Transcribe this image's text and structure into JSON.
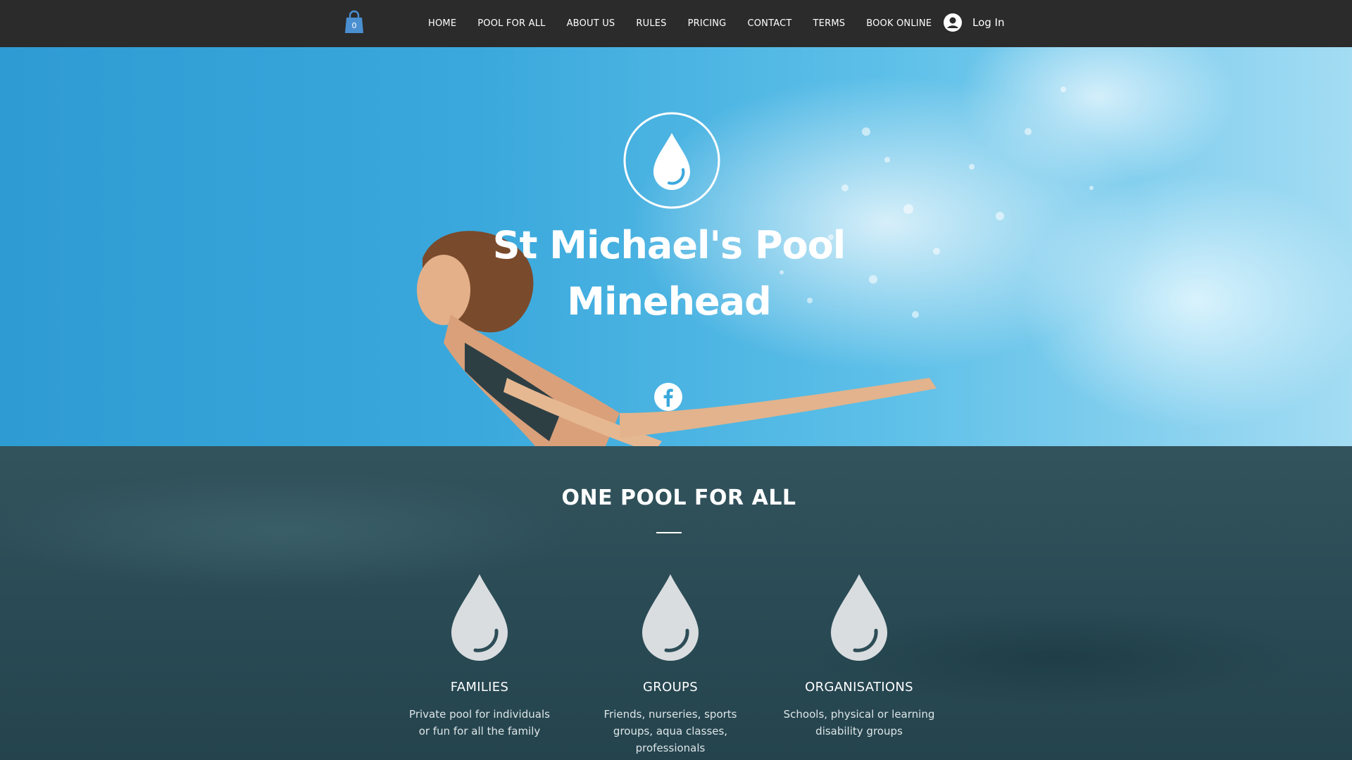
{
  "cart": {
    "count": "0",
    "icon": "shopping-bag-icon"
  },
  "nav": {
    "items": [
      {
        "label": "HOME"
      },
      {
        "label": "POOL FOR ALL"
      },
      {
        "label": "ABOUT US"
      },
      {
        "label": "RULES"
      },
      {
        "label": "PRICING"
      },
      {
        "label": "CONTACT"
      },
      {
        "label": "TERMS"
      },
      {
        "label": "BOOK ONLINE"
      }
    ]
  },
  "login": {
    "label": "Log In",
    "icon": "user-avatar-icon"
  },
  "hero": {
    "title_line1": "St Michael's Pool",
    "title_line2": "Minehead",
    "logo_icon": "water-drop-icon",
    "social_icon": "facebook-icon"
  },
  "section": {
    "title": "ONE POOL FOR ALL",
    "features": [
      {
        "title": "FAMILIES",
        "desc": "Private pool for individuals or fun for all the family",
        "icon": "water-drop-icon"
      },
      {
        "title": "GROUPS",
        "desc": "Friends, nurseries, sports groups, aqua classes, professionals",
        "icon": "water-drop-icon"
      },
      {
        "title": "ORGANISATIONS",
        "desc": "Schools, physical or learning disability groups",
        "icon": "water-drop-icon"
      }
    ]
  },
  "colors": {
    "topbar": "#2b2b2b",
    "cart_icon": "#4a8fd0",
    "section_bg": "#2a4a55",
    "drop_icon": "#d9dddf"
  }
}
